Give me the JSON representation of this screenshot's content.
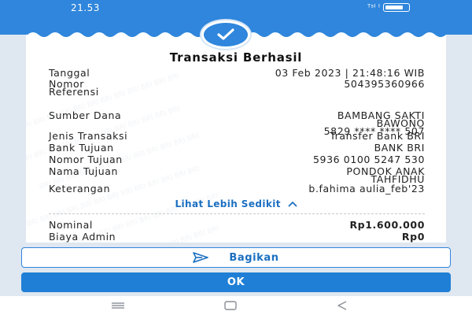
{
  "status": {
    "time": "21.53",
    "signal": "ᵀˢᴵ ᴵ"
  },
  "title": "Transaksi Berhasil",
  "details": [
    {
      "label": "Tanggal",
      "value": "03 Feb 2023 | 21:48:16 WIB"
    },
    {
      "label": "Nomor",
      "label2": "Referensi",
      "value": "504395360966"
    },
    {
      "label": "Sumber Dana",
      "value": "BAMBANG SAKTI",
      "value2": "BAWONO",
      "value3": "5829 **** **** 507"
    },
    {
      "label": "Jenis Transaksi",
      "value": "Transfer Bank BRI"
    },
    {
      "label": "Bank Tujuan",
      "value": "BANK BRI"
    },
    {
      "label": "Nomor Tujuan",
      "value": "5936 0100 5247 530"
    },
    {
      "label": "Nama Tujuan",
      "value": "PONDOK ANAK",
      "value2": "TAHFIDHU"
    },
    {
      "label": "Keterangan",
      "value": "b.fahima aulia_feb'23"
    }
  ],
  "toggle_label": "Lihat Lebih Sedikit",
  "amounts": [
    {
      "label": "Nominal",
      "value": "Rp1.600.000"
    },
    {
      "label": "Biaya Admin",
      "value": "Rp0"
    }
  ],
  "buttons": {
    "share": "Bagikan",
    "ok": "OK"
  },
  "icons": {
    "check": "check-icon",
    "share": "send-icon",
    "chevron": "chevron-up-icon",
    "nav_recents": "recents-icon",
    "nav_home": "home-icon",
    "nav_back": "back-icon"
  },
  "colors": {
    "primary": "#2f86dc",
    "button": "#1f7fd6",
    "link": "#1b6fc1"
  }
}
